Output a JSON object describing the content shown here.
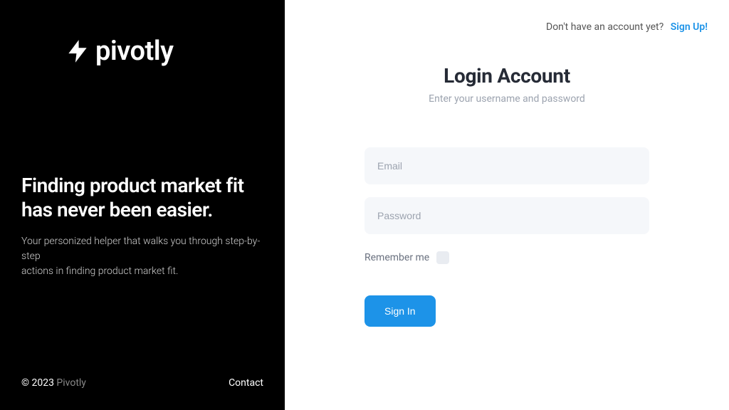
{
  "brand": {
    "name": "pivotly"
  },
  "marketing": {
    "headline": "Finding product market fit has never been easier.",
    "subtext_line1": "Your personized helper that walks you through step-by-step",
    "subtext_line2": "actions in finding product market fit."
  },
  "footer": {
    "copyright_prefix": "© 2023 ",
    "copyright_brand": "Pivotly",
    "contact": "Contact"
  },
  "signup": {
    "prompt": "Don't have an account yet?",
    "link": "Sign Up!"
  },
  "form": {
    "title": "Login Account",
    "subtitle": "Enter your username and password",
    "email_placeholder": "Email",
    "password_placeholder": "Password",
    "remember_label": "Remember me",
    "signin_button": "Sign In"
  }
}
